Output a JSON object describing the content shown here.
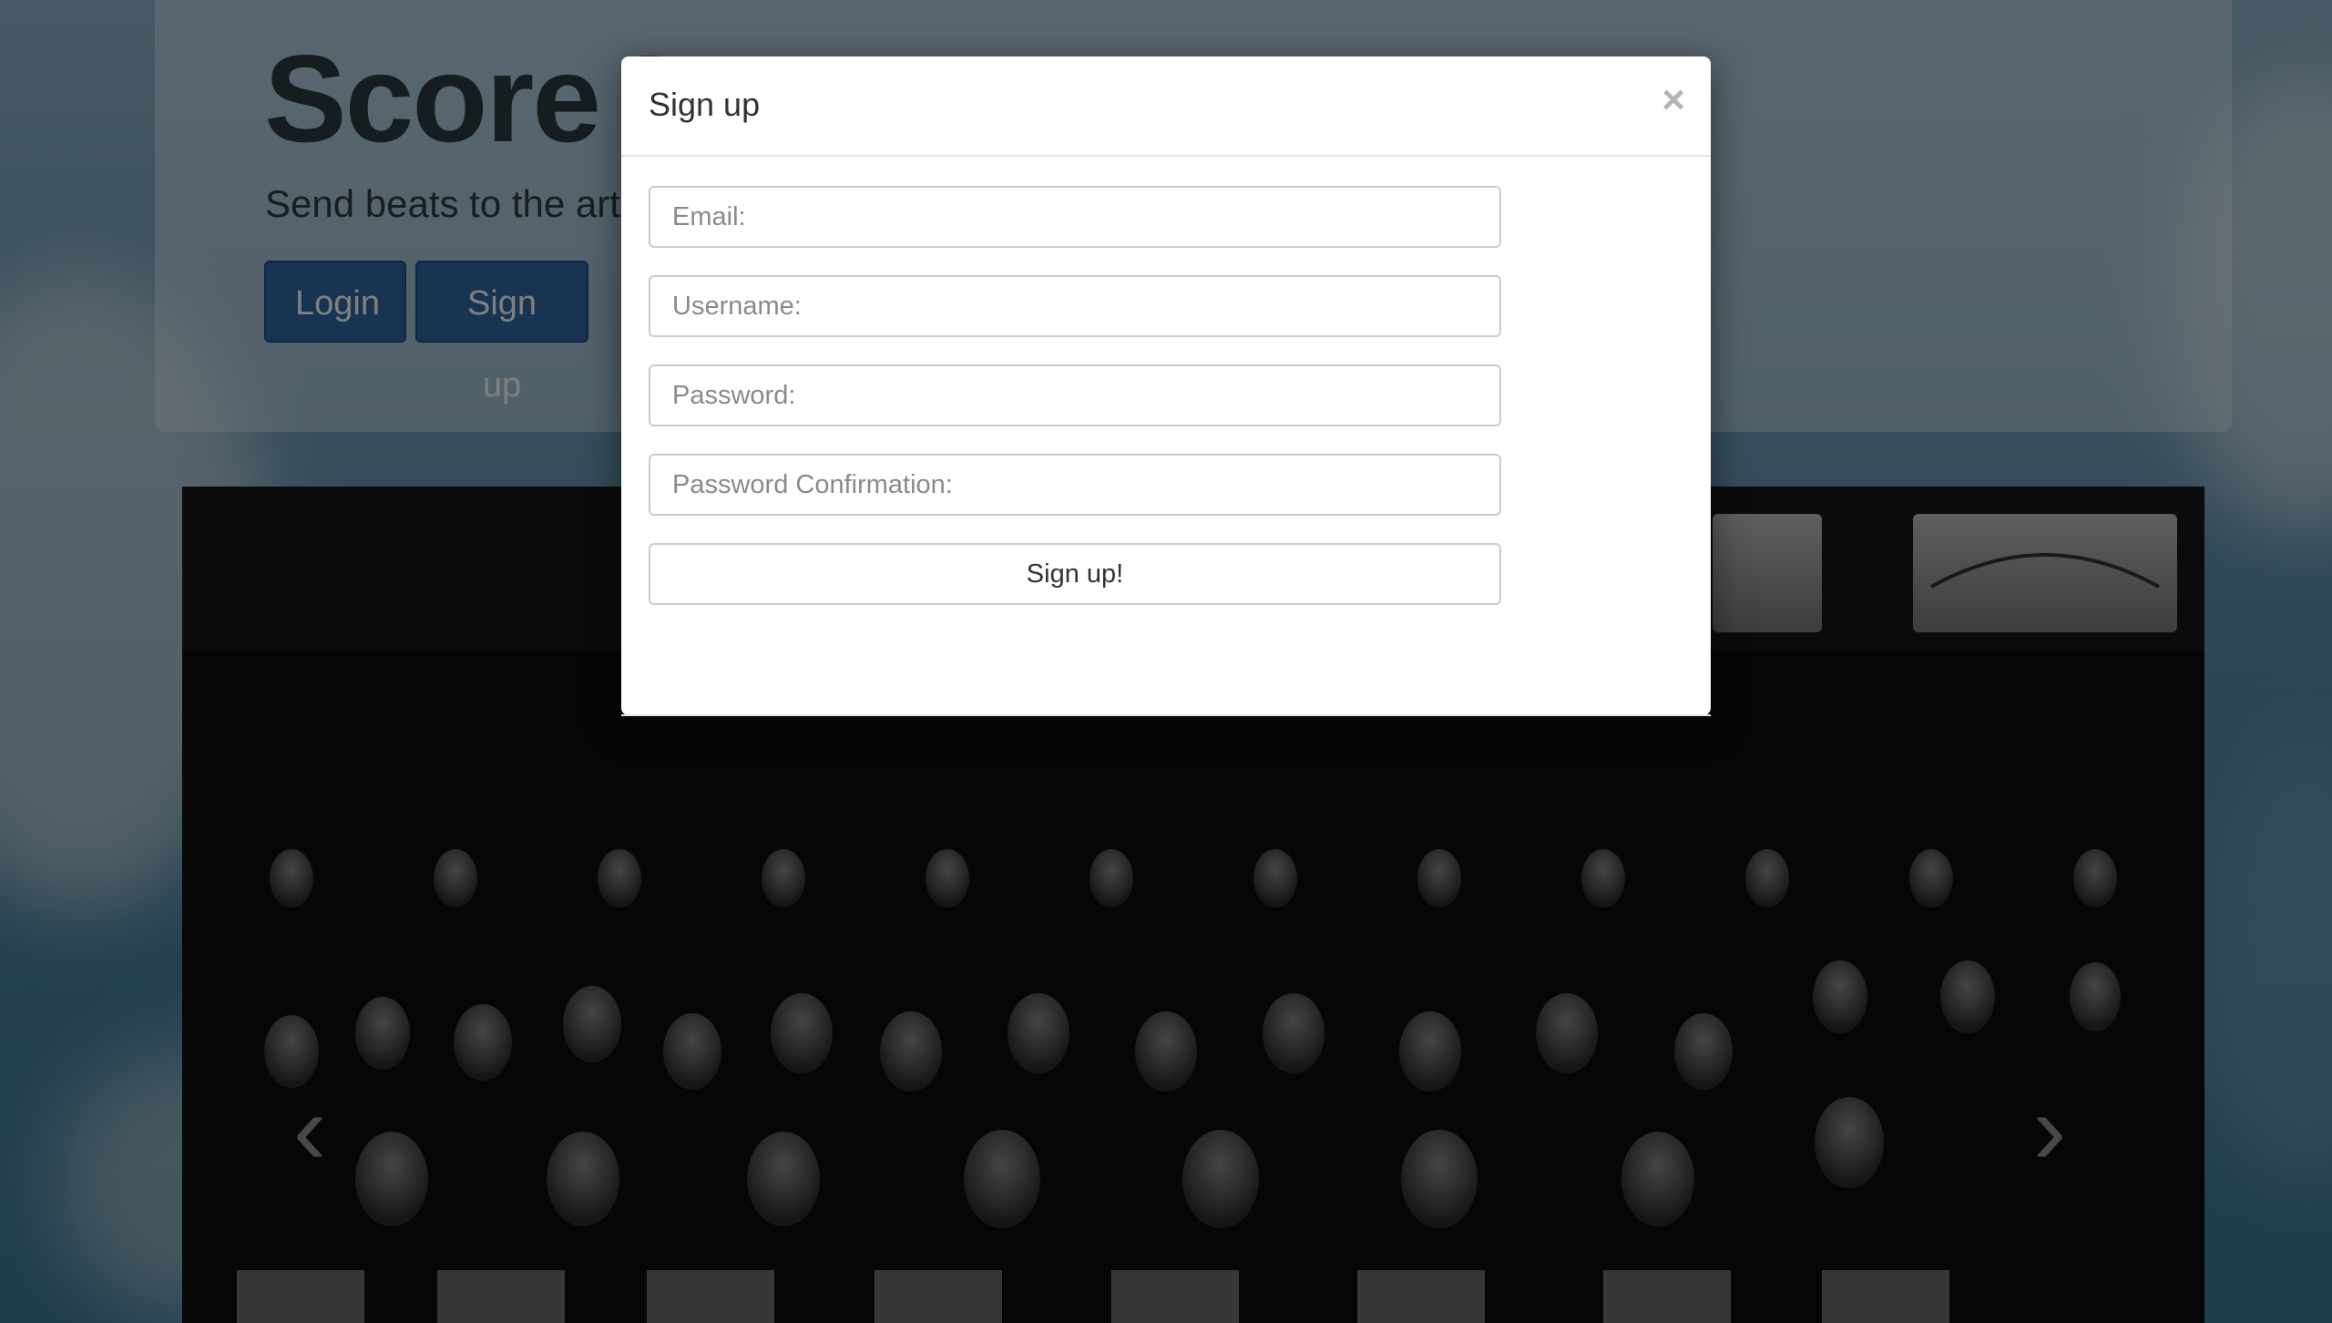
{
  "header": {
    "title": "Score I",
    "tagline": "Send beats to the artis"
  },
  "hero_buttons": {
    "login_label": "Login",
    "signup_label": "Sign up"
  },
  "carousel": {
    "prev_glyph": "‹",
    "next_glyph": "›"
  },
  "modal": {
    "title": "Sign up",
    "close_glyph": "×",
    "fields": {
      "email_placeholder": "Email:",
      "username_placeholder": "Username:",
      "password_placeholder": "Password:",
      "password_confirmation_placeholder": "Password Confirmation:"
    },
    "submit_label": "Sign up!"
  },
  "colors": {
    "primary_button": "#2f6aa7",
    "backdrop": "rgba(0,0,0,0.5)",
    "modal_background": "#ffffff"
  }
}
